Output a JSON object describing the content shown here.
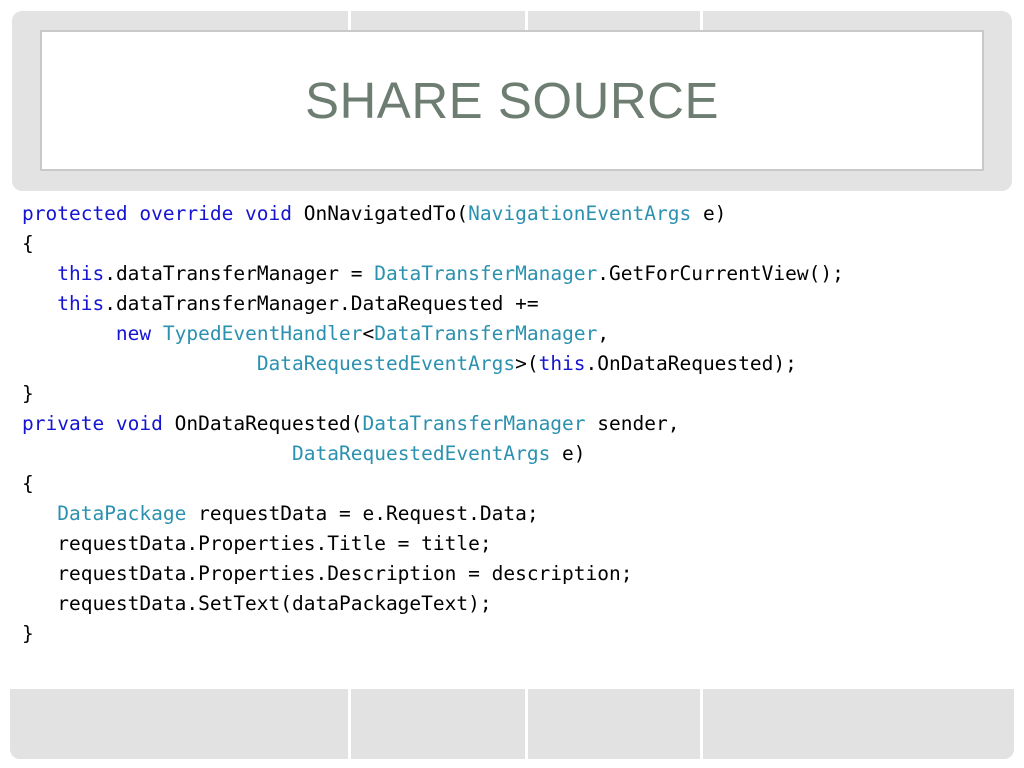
{
  "slide": {
    "title": "SHARE SOURCE",
    "title_color": "#6e7d72",
    "banner_color": "#e3e3e3",
    "frame_border_color": "#c9c9c9",
    "footer_color": "#e2e2e2",
    "divider_positions": [
      348,
      525,
      700
    ]
  },
  "code": {
    "language": "csharp",
    "keyword_color": "#1414d2",
    "type_color": "#2b91af",
    "plain_color": "#000000",
    "lines": [
      [
        {
          "t": "protected override void ",
          "c": "kw"
        },
        {
          "t": "OnNavigatedTo(",
          "c": "pln"
        },
        {
          "t": "NavigationEventArgs",
          "c": "typ"
        },
        {
          "t": " e)",
          "c": "pln"
        }
      ],
      [
        {
          "t": "{",
          "c": "pln"
        }
      ],
      [
        {
          "t": "   ",
          "c": "pln"
        },
        {
          "t": "this",
          "c": "kw"
        },
        {
          "t": ".dataTransferManager = ",
          "c": "pln"
        },
        {
          "t": "DataTransferManager",
          "c": "typ"
        },
        {
          "t": ".GetForCurrentView();",
          "c": "pln"
        }
      ],
      [
        {
          "t": "   ",
          "c": "pln"
        },
        {
          "t": "this",
          "c": "kw"
        },
        {
          "t": ".dataTransferManager.DataRequested +=",
          "c": "pln"
        }
      ],
      [
        {
          "t": "        ",
          "c": "pln"
        },
        {
          "t": "new",
          "c": "kw"
        },
        {
          "t": " ",
          "c": "pln"
        },
        {
          "t": "TypedEventHandler",
          "c": "typ"
        },
        {
          "t": "<",
          "c": "pln"
        },
        {
          "t": "DataTransferManager",
          "c": "typ"
        },
        {
          "t": ",",
          "c": "pln"
        }
      ],
      [
        {
          "t": "                    ",
          "c": "pln"
        },
        {
          "t": "DataRequestedEventArgs",
          "c": "typ"
        },
        {
          "t": ">(",
          "c": "pln"
        },
        {
          "t": "this",
          "c": "kw"
        },
        {
          "t": ".OnDataRequested);",
          "c": "pln"
        }
      ],
      [
        {
          "t": "}",
          "c": "pln"
        }
      ],
      [
        {
          "t": "private void ",
          "c": "kw"
        },
        {
          "t": "OnDataRequested(",
          "c": "pln"
        },
        {
          "t": "DataTransferManager",
          "c": "typ"
        },
        {
          "t": " sender,",
          "c": "pln"
        }
      ],
      [
        {
          "t": "                       ",
          "c": "pln"
        },
        {
          "t": "DataRequestedEventArgs",
          "c": "typ"
        },
        {
          "t": " e)",
          "c": "pln"
        }
      ],
      [
        {
          "t": "{",
          "c": "pln"
        }
      ],
      [
        {
          "t": "   ",
          "c": "pln"
        },
        {
          "t": "DataPackage",
          "c": "typ"
        },
        {
          "t": " requestData = e.Request.Data;",
          "c": "pln"
        }
      ],
      [
        {
          "t": "   requestData.Properties.Title = title;",
          "c": "pln"
        }
      ],
      [
        {
          "t": "   requestData.Properties.Description = description;",
          "c": "pln"
        }
      ],
      [
        {
          "t": "   requestData.SetText(dataPackageText);",
          "c": "pln"
        }
      ],
      [
        {
          "t": "}",
          "c": "pln"
        }
      ]
    ]
  }
}
